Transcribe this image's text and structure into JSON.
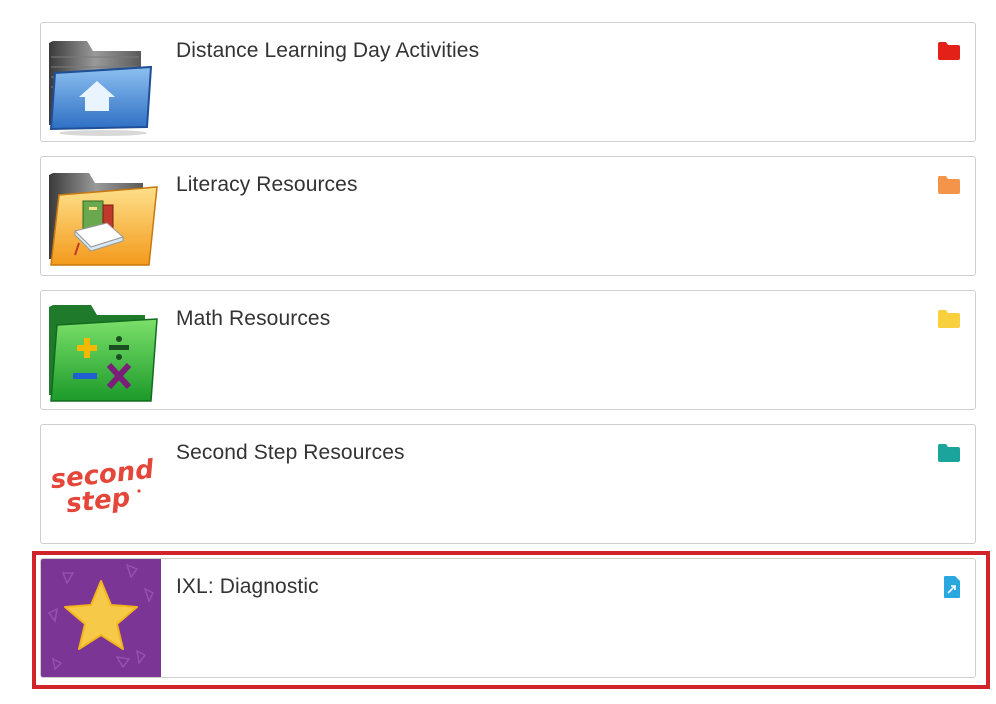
{
  "items": [
    {
      "title": "Distance Learning Day Activities",
      "type": "folder",
      "type_icon": "folder-icon",
      "type_color": "#e32119",
      "thumb_icon": "home-folder-icon"
    },
    {
      "title": "Literacy Resources",
      "type": "folder",
      "type_icon": "folder-icon",
      "type_color": "#f4944a",
      "thumb_icon": "books-folder-icon"
    },
    {
      "title": "Math Resources",
      "type": "folder",
      "type_icon": "folder-icon",
      "type_color": "#f8cf3c",
      "thumb_icon": "math-folder-icon"
    },
    {
      "title": "Second Step Resources",
      "type": "folder",
      "type_icon": "folder-icon",
      "type_color": "#1ba49c",
      "thumb_icon": "second-step-logo",
      "thumb_logo_text": "Second Step"
    },
    {
      "title": "IXL: Diagnostic",
      "type": "link",
      "type_icon": "external-link-file-icon",
      "type_color": "#29a8e0",
      "thumb_icon": "star-icon",
      "thumb_bg": "#7b3594",
      "highlighted": true
    }
  ],
  "colors": {
    "highlight_border": "#d0242a",
    "card_border": "#cfcfcf",
    "title_text": "#333333"
  }
}
